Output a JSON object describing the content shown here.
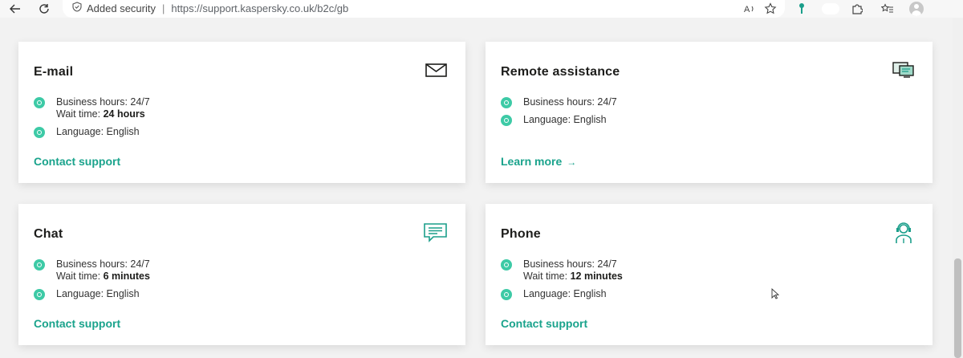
{
  "browser": {
    "security_label": "Added security",
    "separator": "|",
    "url": "https://support.kaspersky.co.uk/b2c/gb"
  },
  "colors": {
    "accent": "#1aa38c",
    "dot": "#3dcaa6",
    "title": "#1d1d1b"
  },
  "cards": [
    {
      "title": "E-mail",
      "icon": "envelope-icon",
      "hours": "Business hours: 24/7",
      "wait_prefix": "Wait time: ",
      "wait_value": "24 hours",
      "language": "Language: English",
      "link": "Contact support"
    },
    {
      "title": "Remote assistance",
      "icon": "remote-desktop-icon",
      "hours": "Business hours: 24/7",
      "language": "Language: English",
      "link": "Learn more",
      "link_arrow": "→"
    },
    {
      "title": "Chat",
      "icon": "chat-bubble-icon",
      "hours": "Business hours: 24/7",
      "wait_prefix": "Wait time: ",
      "wait_value": "6 minutes",
      "language": "Language: English",
      "link": "Contact support"
    },
    {
      "title": "Phone",
      "icon": "headset-icon",
      "hours": "Business hours: 24/7",
      "wait_prefix": "Wait time: ",
      "wait_value": "12 minutes",
      "language": "Language: English",
      "link": "Contact support"
    }
  ]
}
